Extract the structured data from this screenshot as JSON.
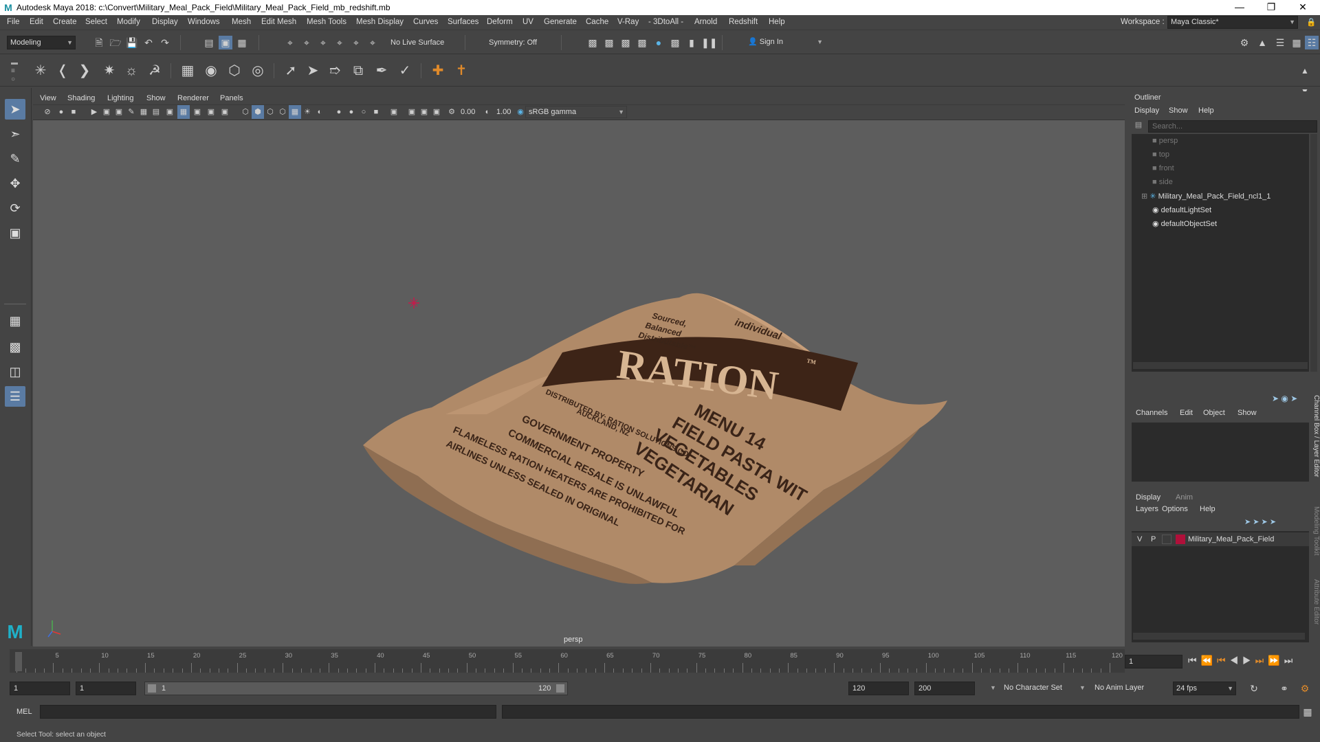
{
  "window": {
    "title": "Autodesk Maya 2018: c:\\Convert\\Military_Meal_Pack_Field\\Military_Meal_Pack_Field_mb_redshift.mb"
  },
  "menubar": {
    "items": [
      "File",
      "Edit",
      "Create",
      "Select",
      "Modify",
      "Display",
      "Windows",
      "Mesh",
      "Edit Mesh",
      "Mesh Tools",
      "Mesh Display",
      "Curves",
      "Surfaces",
      "Deform",
      "UV",
      "Generate",
      "Cache",
      "V-Ray",
      "- 3DtoAll -",
      "Arnold",
      "Redshift",
      "Help"
    ],
    "workspace_label": "Workspace :",
    "workspace_value": "Maya Classic*"
  },
  "statusline": {
    "mode": "Modeling",
    "live_surface": "No Live Surface",
    "symmetry": "Symmetry: Off",
    "sign_in": "Sign In"
  },
  "viewport": {
    "menu": [
      "View",
      "Shading",
      "Lighting",
      "Show",
      "Renderer",
      "Panels"
    ],
    "exposure": "0.00",
    "gamma": "1.00",
    "color_space": "sRGB gamma",
    "camera_label": "persp",
    "object_texture": {
      "brand": "RATION",
      "trademark": "™",
      "line1": "MENU 14",
      "line2": "FIELD PASTA WIT",
      "line3": "VEGETABLES",
      "line4": "VEGETARIAN",
      "small1": "DISTRIBUTED BY: RATION SOLUTIONS CO.",
      "small2": "AUCKLAND, NZ",
      "small3": "GOVERNMENT PROPERTY",
      "small4": "COMMERCIAL RESALE IS UNLAWFUL",
      "small5": "FLAMELESS RATION HEATERS ARE PROHIBITED FOR",
      "small6": "AIRLINES UNLESS SEALED IN ORIGINAL",
      "top1": "individual",
      "top2": "Sourced,",
      "top3": "Balanced",
      "top4": "Distributable™"
    }
  },
  "outliner": {
    "title": "Outliner",
    "menu": [
      "Display",
      "Show",
      "Help"
    ],
    "search_placeholder": "Search...",
    "items": [
      {
        "label": "persp",
        "dim": true
      },
      {
        "label": "top",
        "dim": true
      },
      {
        "label": "front",
        "dim": true
      },
      {
        "label": "side",
        "dim": true
      },
      {
        "label": "Military_Meal_Pack_Field_ncl1_1",
        "dim": false
      },
      {
        "label": "defaultLightSet",
        "dim": false
      },
      {
        "label": "defaultObjectSet",
        "dim": false
      }
    ]
  },
  "channelbox": {
    "menu": [
      "Channels",
      "Edit",
      "Object",
      "Show"
    ],
    "side_tabs": [
      "Channel Box / Layer Editor",
      "Modeling Toolkit",
      "Attribute Editor"
    ]
  },
  "layers": {
    "tabs": [
      "Display",
      "Anim"
    ],
    "menu": [
      "Layers",
      "Options",
      "Help"
    ],
    "row": {
      "v": "V",
      "p": "P",
      "name": "Military_Meal_Pack_Field",
      "color": "#b0103a"
    }
  },
  "timeline": {
    "ticks": [
      "1",
      "5",
      "10",
      "15",
      "20",
      "25",
      "30",
      "35",
      "40",
      "45",
      "50",
      "55",
      "60",
      "65",
      "70",
      "75",
      "80",
      "85",
      "90",
      "95",
      "100",
      "105",
      "110",
      "115",
      "120"
    ],
    "current_frame": "1"
  },
  "range": {
    "start": "1",
    "playback_start": "1",
    "slider_start": "1",
    "slider_end": "120",
    "playback_end": "120",
    "end": "200",
    "character_set": "No Character Set",
    "anim_layer": "No Anim Layer",
    "fps": "24 fps"
  },
  "cmdline": {
    "lang": "MEL"
  },
  "helpline": {
    "text": "Select Tool: select an object"
  }
}
